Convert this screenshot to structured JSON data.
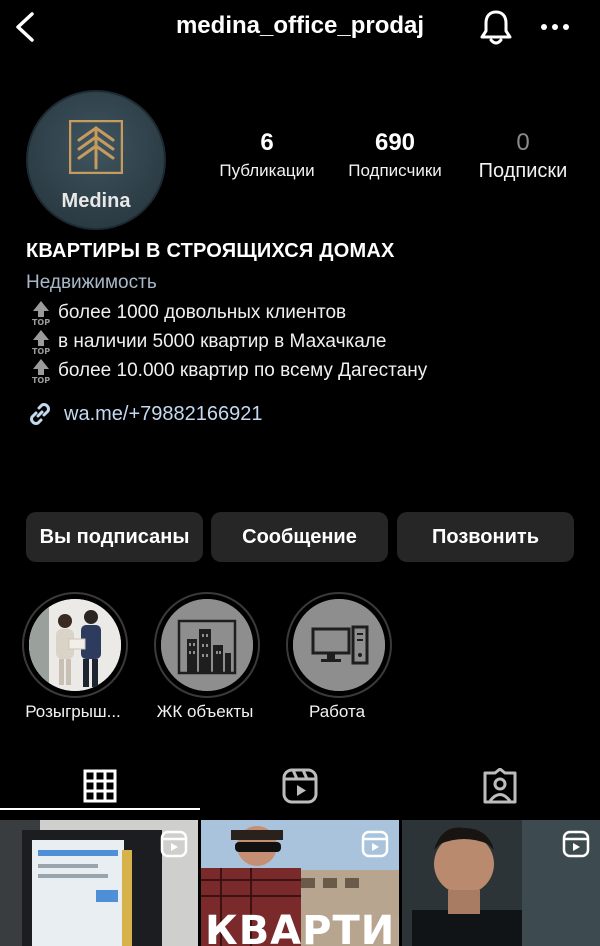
{
  "header": {
    "username": "medina_office_prodaj"
  },
  "profile": {
    "avatar_text": "Medina",
    "stats": [
      {
        "value": "6",
        "label": "Публикации"
      },
      {
        "value": "690",
        "label": "Подписчики"
      },
      {
        "value": "0",
        "label": "Подписки"
      }
    ]
  },
  "bio": {
    "name": "КВАРТИРЫ В СТРОЯЩИХСЯ ДОМАХ",
    "category": "Недвижимость",
    "lines": [
      "более 1000 довольных клиентов",
      "в наличии 5000 квартир в Махачкале",
      "более 10.000 квартир по всему Дагестану"
    ],
    "icon_text": "TOP",
    "link": "wa.me/+79882166921"
  },
  "buttons": {
    "following": "Вы подписаны",
    "message": "Сообщение",
    "call": "Позвонить"
  },
  "highlights": [
    {
      "label": "Розыгрыш...",
      "icon": "people-photo"
    },
    {
      "label": "ЖК объекты",
      "icon": "buildings-icon"
    },
    {
      "label": "Работа",
      "icon": "computer-icon"
    }
  ],
  "grid": {
    "post2_text": "КВАРТИРЫ"
  },
  "colors": {
    "background": "#000000",
    "button": "#262626",
    "link": "#c5d9ef",
    "category": "#a9b8c9"
  }
}
